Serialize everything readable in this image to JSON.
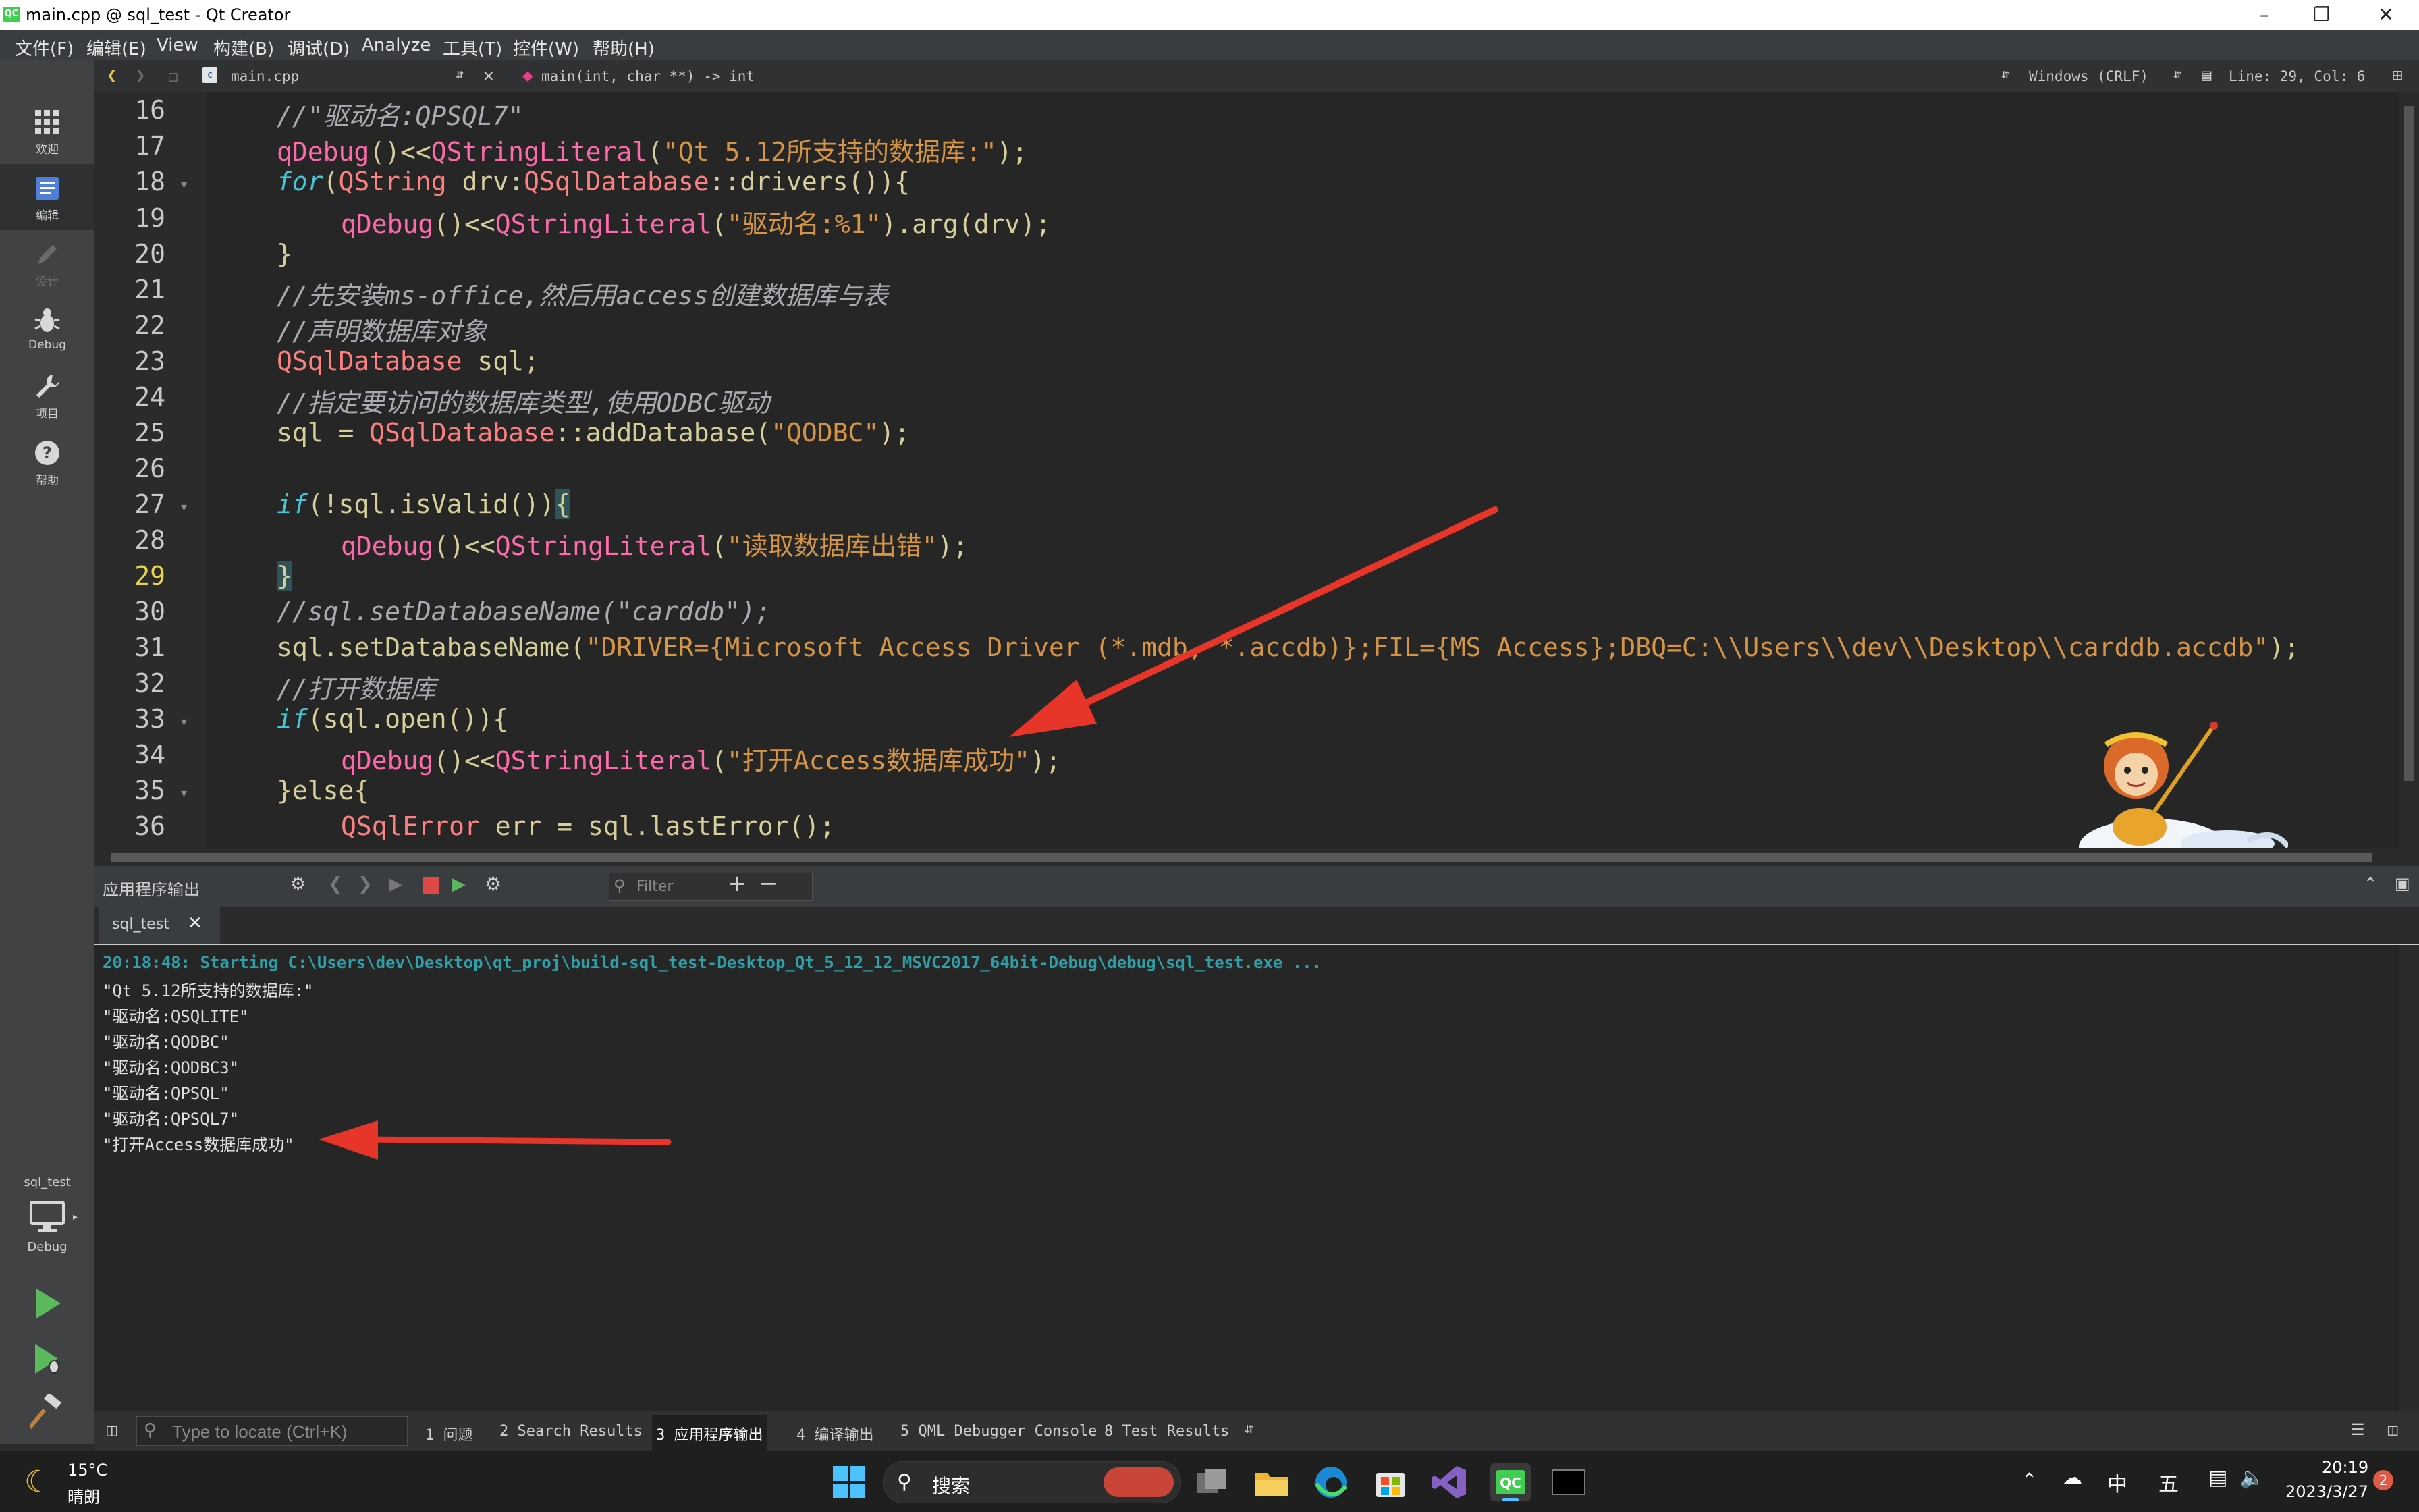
{
  "window": {
    "title": "main.cpp @ sql_test - Qt Creator",
    "app_icon_text": "QC"
  },
  "menu": [
    "文件(F)",
    "编辑(E)",
    "View",
    "构建(B)",
    "调试(D)",
    "Analyze",
    "工具(T)",
    "控件(W)",
    "帮助(H)"
  ],
  "modes": [
    {
      "label": "欢迎",
      "icon": "grid-icon"
    },
    {
      "label": "编辑",
      "icon": "edit-icon"
    },
    {
      "label": "设计",
      "icon": "pencil-icon"
    },
    {
      "label": "Debug",
      "icon": "bug-icon"
    },
    {
      "label": "项目",
      "icon": "wrench-icon"
    },
    {
      "label": "帮助",
      "icon": "help-icon"
    }
  ],
  "kit": {
    "project": "sql_test",
    "config": "Debug"
  },
  "editor_toolbar": {
    "file": "main.cpp",
    "symbol": "main(int, char **) -> int",
    "line_ending": "Windows (CRLF)",
    "position": "Line: 29, Col: 6"
  },
  "line_numbers": [
    "16",
    "17",
    "18",
    "19",
    "20",
    "21",
    "22",
    "23",
    "24",
    "25",
    "26",
    "27",
    "28",
    "29",
    "30",
    "31",
    "32",
    "33",
    "34",
    "35",
    "36"
  ],
  "code": {
    "l16": "//\"驱动名:QPSQL7\"",
    "l17a": "qDebug",
    "l17b": "()<<",
    "l17c": "QStringLiteral",
    "l17d": "(",
    "l17e": "\"Qt 5.12所支持的数据库:\"",
    "l17f": ");",
    "l18a": "for",
    "l18b": "(",
    "l18c": "QString",
    "l18d": " drv:",
    "l18e": "QSqlDatabase",
    "l18f": "::drivers()){",
    "l19a": "qDebug",
    "l19b": "()<<",
    "l19c": "QStringLiteral",
    "l19d": "(",
    "l19e": "\"驱动名:%1\"",
    "l19f": ").arg(drv);",
    "l20": "}",
    "l21": "//先安装ms-office,然后用access创建数据库与表",
    "l22": "//声明数据库对象",
    "l23a": "QSqlDatabase",
    "l23b": " sql;",
    "l24": "//指定要访问的数据库类型,使用ODBC驱动",
    "l25a": "sql = ",
    "l25b": "QSqlDatabase",
    "l25c": "::addDatabase(",
    "l25d": "\"QODBC\"",
    "l25e": ");",
    "l27a": "if",
    "l27b": "(!sql.isValid())",
    "l27c": "{",
    "l28a": "qDebug",
    "l28b": "()<<",
    "l28c": "QStringLiteral",
    "l28d": "(",
    "l28e": "\"读取数据库出错\"",
    "l28f": ");",
    "l29": "}",
    "l30": "//sql.setDatabaseName(\"carddb\");",
    "l31a": "sql.setDatabaseName(",
    "l31b": "\"DRIVER={Microsoft Access Driver (*.mdb, *.accdb)};FIL={MS Access};DBQ=C:\\\\Users\\\\dev\\\\Desktop\\\\carddb.accdb\"",
    "l31c": ");",
    "l32": "//打开数据库",
    "l33a": "if",
    "l33b": "(sql.open()){",
    "l34a": "qDebug",
    "l34b": "()<<",
    "l34c": "QStringLiteral",
    "l34d": "(",
    "l34e": "\"打开Access数据库成功\"",
    "l34f": ");",
    "l35": "}else{",
    "l36a": "QSqlError",
    "l36b": " err = sql.lastError();"
  },
  "output_pane": {
    "title": "应用程序输出",
    "filter_placeholder": "Filter",
    "tab": "sql_test",
    "lines": [
      "20:18:48: Starting C:\\Users\\dev\\Desktop\\qt_proj\\build-sql_test-Desktop_Qt_5_12_12_MSVC2017_64bit-Debug\\debug\\sql_test.exe ...",
      "\"Qt 5.12所支持的数据库:\"",
      "\"驱动名:QSQLITE\"",
      "\"驱动名:QODBC\"",
      "\"驱动名:QODBC3\"",
      "\"驱动名:QPSQL\"",
      "\"驱动名:QPSQL7\"",
      "\"打开Access数据库成功\""
    ]
  },
  "statusbar": {
    "locate_placeholder": "Type to locate (Ctrl+K)",
    "tabs": [
      "1 问题",
      "2 Search Results",
      "3 应用程序输出",
      "4 编译输出",
      "5 QML Debugger Console",
      "8 Test Results"
    ]
  },
  "taskbar": {
    "weather_temp": "15°C",
    "weather_desc": "晴朗",
    "search_label": "搜索",
    "ime1": "中",
    "ime2": "五",
    "time": "20:19",
    "date": "2023/3/27",
    "notif_count": "2"
  },
  "colors": {
    "accent_red": "#e8352a",
    "qt_green": "#41cd52"
  }
}
